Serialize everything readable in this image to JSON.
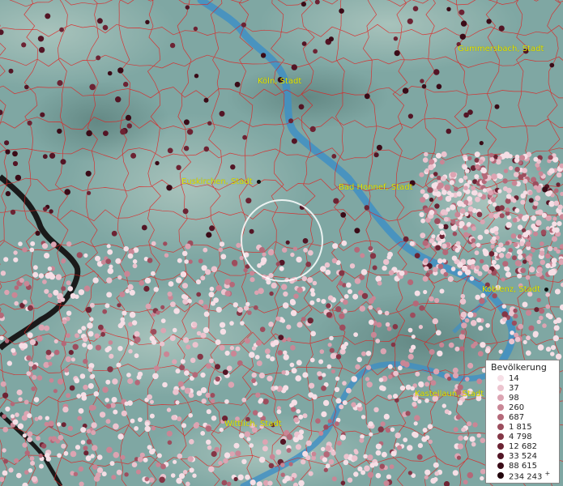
{
  "places": [
    {
      "name": "Gummersbach, Stadt",
      "id": "gummersbach"
    },
    {
      "name": "Köln, Stadt",
      "id": "koeln"
    },
    {
      "name": "Euskirchen, Stadt",
      "id": "euskirchen"
    },
    {
      "name": "Bad Honnef, Stadt",
      "id": "bad-honnef"
    },
    {
      "name": "Koblenz, Stadt",
      "id": "koblenz"
    },
    {
      "name": "Kastellaun, Stadt",
      "id": "kastellaun"
    },
    {
      "name": "Wittlich, Stadt",
      "id": "wittlich"
    }
  ],
  "legend": {
    "title": "Bevölkerung",
    "entries": [
      {
        "label": "14",
        "color": "#f6dfe6"
      },
      {
        "label": "37",
        "color": "#ecc4cf"
      },
      {
        "label": "98",
        "color": "#dca4b2"
      },
      {
        "label": "260",
        "color": "#c98695"
      },
      {
        "label": "687",
        "color": "#b46878"
      },
      {
        "label": "1 815",
        "color": "#9c4d5d"
      },
      {
        "label": "4 798",
        "color": "#843646"
      },
      {
        "label": "12 682",
        "color": "#6c2333"
      },
      {
        "label": "33 524",
        "color": "#531525"
      },
      {
        "label": "88 615",
        "color": "#3a0b17"
      },
      {
        "label": "234 243",
        "color": "#22050c",
        "suffix": "+"
      }
    ]
  },
  "colors": {
    "river": "#3f8fc4",
    "boundary": "#e02020",
    "border": "#1a1a1a",
    "label": "#e6e600",
    "terrain": "#7fa7a3"
  }
}
